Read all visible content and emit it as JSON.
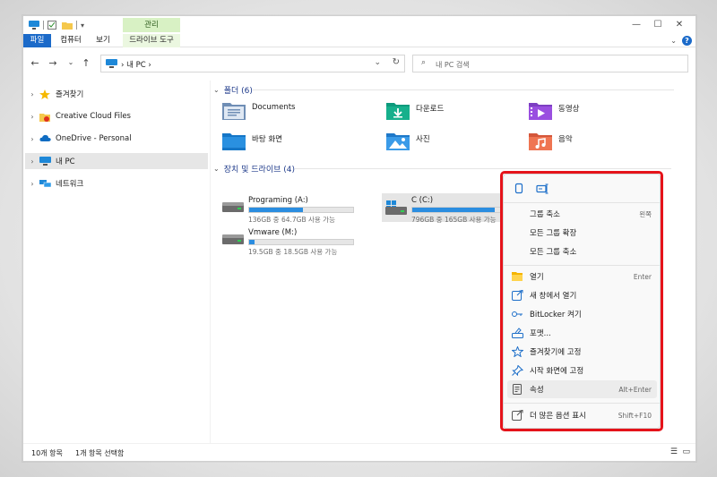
{
  "titlebar": {
    "contextual_tab_header": "관리",
    "minimize": "—",
    "maximize": "☐",
    "close": "✕"
  },
  "ribbon": {
    "tabs": [
      "파일",
      "컴퓨터",
      "보기",
      "드라이브 도구"
    ],
    "expand": "⌄",
    "help": "?"
  },
  "address": {
    "back": "←",
    "forward": "→",
    "recent": "⌄",
    "up": "↑",
    "path": "› 내 PC ›",
    "dropdown": "⌄",
    "refresh": "↻",
    "search_icon": "⌕",
    "search_placeholder": "내 PC 검색"
  },
  "navpane": {
    "items": [
      {
        "label": "즐겨찾기",
        "icon": "star-icon",
        "arrow": "›"
      },
      {
        "label": "Creative Cloud Files",
        "icon": "creative-cloud-folder-icon",
        "arrow": "›"
      },
      {
        "label": "OneDrive - Personal",
        "icon": "onedrive-cloud-icon",
        "arrow": "›"
      },
      {
        "label": "내 PC",
        "icon": "this-pc-icon",
        "arrow": "›"
      },
      {
        "label": "네트워크",
        "icon": "network-icon",
        "arrow": "›"
      }
    ]
  },
  "content": {
    "folders_header": "폴더 (6)",
    "folders": [
      {
        "name": "Documents",
        "icon": "documents-folder-icon"
      },
      {
        "name": "다운로드",
        "icon": "downloads-folder-icon"
      },
      {
        "name": "동영상",
        "icon": "videos-folder-icon"
      },
      {
        "name": "바탕 화면",
        "icon": "desktop-folder-icon"
      },
      {
        "name": "사진",
        "icon": "pictures-folder-icon"
      },
      {
        "name": "음악",
        "icon": "music-folder-icon"
      }
    ],
    "drives_header": "장치 및 드라이브 (4)",
    "drives": [
      {
        "name": "Programing (A:)",
        "free": "136GB 중 64.7GB 사용 가능",
        "used_fraction": 0.52
      },
      {
        "name": "C (C:)",
        "free": "796GB 중 165GB 사용 가능",
        "used_fraction": 0.79
      },
      {
        "name": "Vmware (M:)",
        "free": "19.5GB 중 18.5GB 사용 가능",
        "used_fraction": 0.05
      }
    ]
  },
  "context_menu": {
    "top_icons": [
      "copy-icon",
      "rename-icon"
    ],
    "items": [
      {
        "label": "그룹 축소",
        "key": "왼쪽",
        "icon": ""
      },
      {
        "label": "모든 그룹 확장",
        "key": "",
        "icon": ""
      },
      {
        "label": "모든 그룹 축소",
        "key": "",
        "icon": ""
      },
      {
        "label": "열기",
        "key": "Enter",
        "icon": "folder-open-icon"
      },
      {
        "label": "새 창에서 열기",
        "key": "",
        "icon": "open-new-window-icon"
      },
      {
        "label": "BitLocker 켜기",
        "key": "",
        "icon": "bitlocker-key-icon"
      },
      {
        "label": "포맷...",
        "key": "",
        "icon": "format-drive-icon"
      },
      {
        "label": "즐겨찾기에 고정",
        "key": "",
        "icon": "star-outline-icon"
      },
      {
        "label": "시작 화면에 고정",
        "key": "",
        "icon": "pin-icon"
      },
      {
        "label": "속성",
        "key": "Alt+Enter",
        "icon": "properties-icon"
      },
      {
        "label": "더 많은 옵션 표시",
        "key": "Shift+F10",
        "icon": "more-options-icon"
      }
    ]
  },
  "statusbar": {
    "item_count": "10개 항목",
    "selected": "1개 항목 선택함",
    "details_view": "☰",
    "tiles_view": "▭"
  },
  "colors": {
    "accent": "#1b6ac9",
    "drive_bar": "#2b8de0",
    "highlight_frame": "#e5131a",
    "contextual_tab": "#d8f1c4"
  }
}
